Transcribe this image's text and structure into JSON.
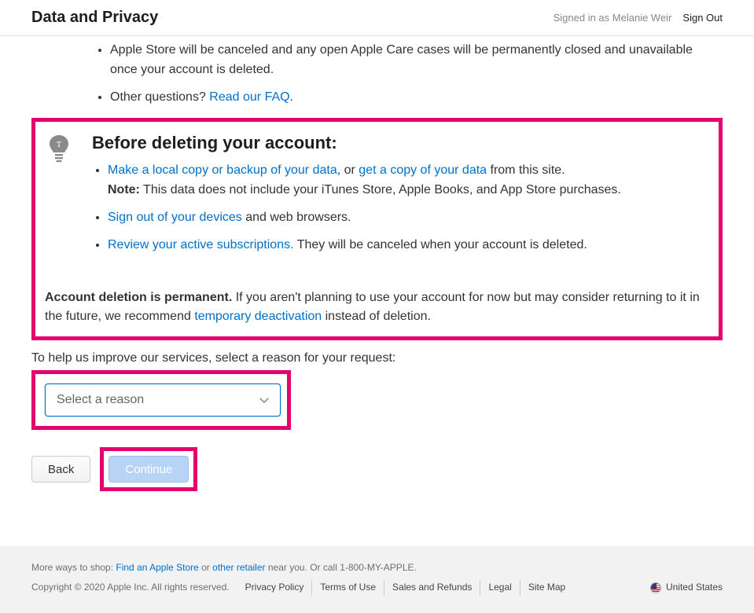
{
  "header": {
    "title": "Data and Privacy",
    "signed_in_prefix": "Signed in as ",
    "signed_in_name": "Melanie Weir",
    "sign_out": "Sign Out"
  },
  "top_list": {
    "item1_partial": "Apple Store will be canceled and any open Apple Care cases will be permanently closed and unavailable once your account is deleted.",
    "item2_prefix": "Other questions? ",
    "item2_link": "Read our FAQ",
    "item2_suffix": "."
  },
  "before": {
    "heading": "Before deleting your account:",
    "i1_link1": "Make a local copy or backup of your data",
    "i1_mid": ", or ",
    "i1_link2": "get a copy of your data",
    "i1_suffix": " from this site.",
    "i1_note_label": "Note:",
    "i1_note_text": " This data does not include your iTunes Store, Apple Books, and App Store purchases.",
    "i2_link": "Sign out of your devices",
    "i2_suffix": " and web browsers.",
    "i3_link": "Review your active subscriptions.",
    "i3_suffix": " They will be canceled when your account is deleted."
  },
  "perm": {
    "strong": "Account deletion is permanent.",
    "mid": " If you aren't planning to use your account for now but may consider returning to it in the future, we recommend ",
    "link": "temporary deactivation",
    "suffix": " instead of deletion."
  },
  "help_text": "To help us improve our services, select a reason for your request:",
  "select_placeholder": "Select a reason",
  "buttons": {
    "back": "Back",
    "continue": "Continue"
  },
  "footer": {
    "row1_pre": "More ways to shop: ",
    "row1_link1": "Find an Apple Store",
    "row1_mid": " or ",
    "row1_link2": "other retailer",
    "row1_suf": " near you. Or call 1-800-MY-APPLE.",
    "copyright": "Copyright © 2020 Apple Inc. All rights reserved.",
    "links": [
      "Privacy Policy",
      "Terms of Use",
      "Sales and Refunds",
      "Legal",
      "Site Map"
    ],
    "region": "United States"
  }
}
